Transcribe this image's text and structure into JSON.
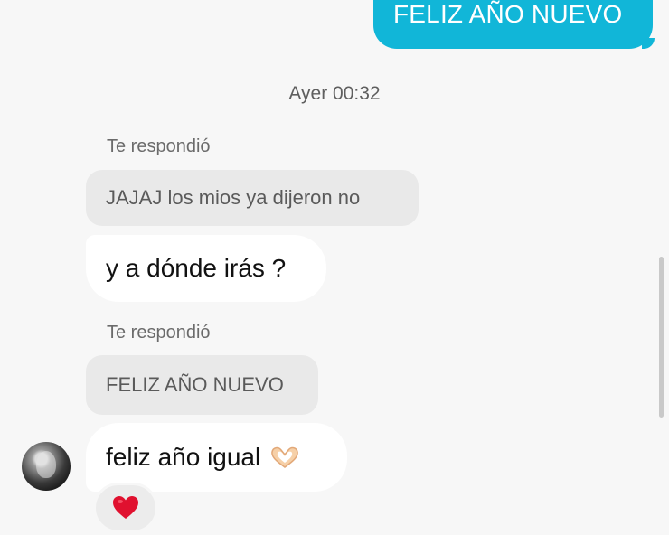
{
  "conversation": {
    "sent_message": "FELIZ AÑO NUEVO",
    "timestamp": "Ayer 00:32",
    "thread": [
      {
        "reply_caption": "Te respondió",
        "quoted_text": "JAJAJ los mios ya dijeron no",
        "message": "y a dónde irás ?"
      },
      {
        "reply_caption": "Te respondió",
        "quoted_text": "FELIZ AÑO NUEVO",
        "message": "feliz año igual"
      }
    ],
    "reaction_icon": "red-heart-icon",
    "message_emoji": "heart-hands-icon"
  },
  "colors": {
    "sent_bubble": "#11b6d8",
    "background": "#f7f7f7",
    "received_bubble": "#ffffff",
    "quoted_bubble": "#e9e9e9",
    "reaction_heart": "#e0112f"
  }
}
